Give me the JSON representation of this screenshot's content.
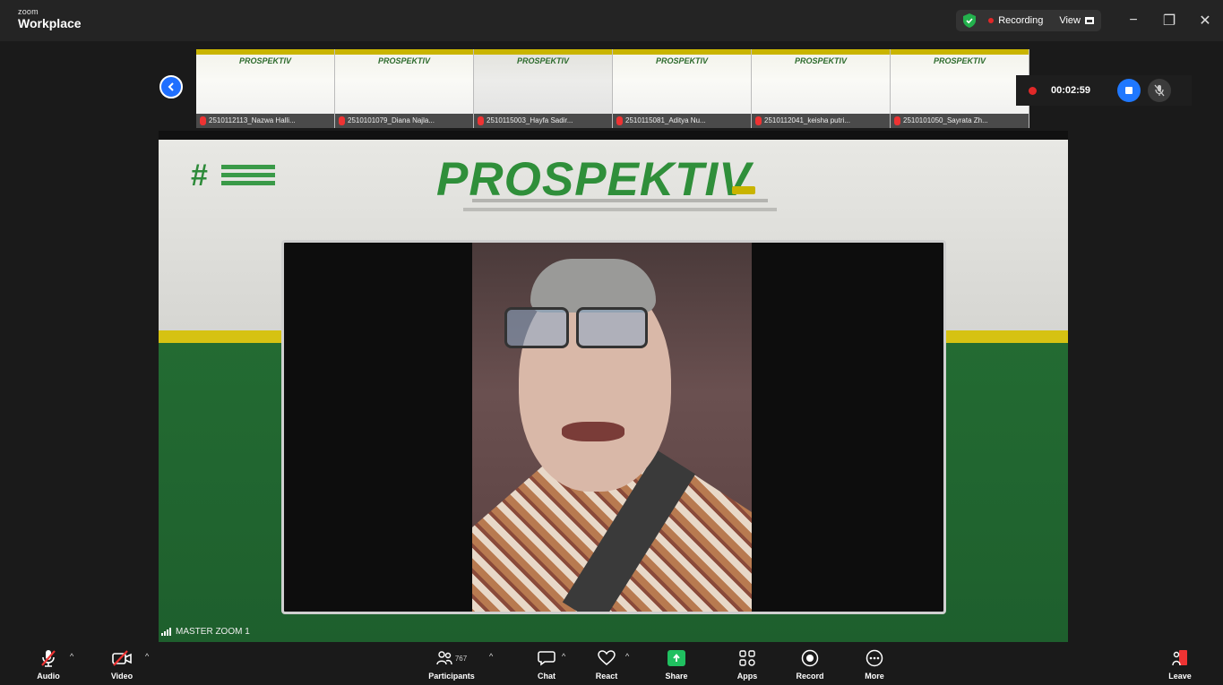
{
  "app": {
    "brand_small": "zoom",
    "brand_big": "Workplace"
  },
  "titlebar": {
    "recording_label": "Recording",
    "view_label": "View"
  },
  "window_controls": {
    "minimize": "−",
    "restore": "❐",
    "close": "✕"
  },
  "thumbnails": [
    {
      "logo": "PROSPEKTIV",
      "name": "2510112113_Nazwa Halli..."
    },
    {
      "logo": "PROSPEKTIV",
      "name": "2510101079_Diana Najla..."
    },
    {
      "logo": "PROSPEKTIV",
      "name": "2510115003_Hayfa Sadir..."
    },
    {
      "logo": "PROSPEKTIV",
      "name": "2510115081_Aditya Nu..."
    },
    {
      "logo": "PROSPEKTIV",
      "name": "2510112041_keisha putri..."
    },
    {
      "logo": "PROSPEKTIV",
      "name": "2510101050_Sayrata Zh..."
    }
  ],
  "recording": {
    "elapsed": "00:02:59"
  },
  "stage": {
    "logo_text": "PROSPEKTIV",
    "speaker_name": "MASTER ZOOM 1"
  },
  "toolbar": {
    "audio": "Audio",
    "video": "Video",
    "participants": "Participants",
    "participants_count": "767",
    "chat": "Chat",
    "react": "React",
    "share": "Share",
    "apps": "Apps",
    "record": "Record",
    "more": "More",
    "leave": "Leave"
  },
  "colors": {
    "accent_blue": "#1f6fff",
    "record_red": "#e02828",
    "share_green": "#20c060",
    "brand_green": "#2f8f3a",
    "brand_yellow": "#d6c212"
  }
}
